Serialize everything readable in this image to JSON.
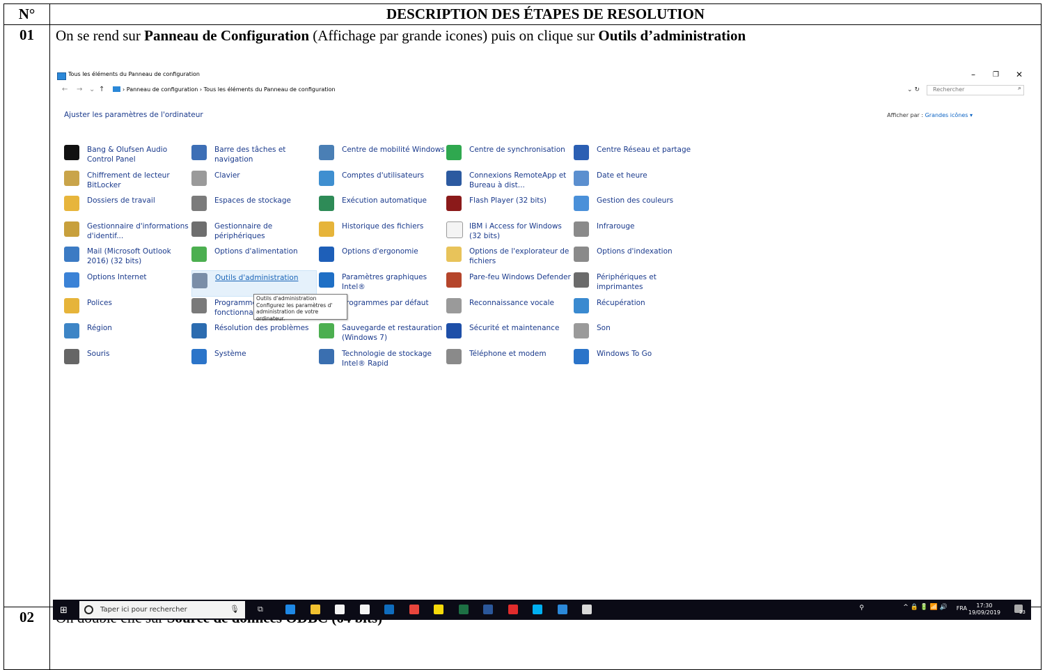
{
  "header": {
    "col_n": "N°",
    "col_desc": "DESCRIPTION DES ÉTAPES DE RESOLUTION"
  },
  "steps": [
    {
      "num": "01",
      "text_parts": [
        "On se rend sur ",
        "Panneau de Configuration",
        " (Affichage par grande icones) puis on clique sur ",
        "Outils d’administration"
      ]
    },
    {
      "num": "02",
      "text_parts": [
        "On double clic sur ",
        "Source de données ODBC (64 bits)"
      ]
    }
  ],
  "screenshot": {
    "window_title": "Tous les éléments du Panneau de configuration",
    "breadcrumb": "›  Panneau de configuration  ›  Tous les éléments du Panneau de configuration",
    "search_placeholder": "Rechercher",
    "adjust_link": "Ajuster les paramètres de l'ordinateur",
    "view_by_label": "Afficher par :",
    "view_by_value": "Grandes icônes ▾",
    "items": [
      {
        "label": "Bang & Olufsen Audio Control Panel",
        "icon": "bang-olufsen-icon",
        "color": "#111111"
      },
      {
        "label": "Barre des tâches et navigation",
        "icon": "taskbar-icon",
        "color": "#3d6fb6"
      },
      {
        "label": "Centre de mobilité Windows",
        "icon": "mobility-center-icon",
        "color": "#4a7fb5"
      },
      {
        "label": "Centre de synchronisation",
        "icon": "sync-center-icon",
        "color": "#2fa84f"
      },
      {
        "label": "Centre Réseau et partage",
        "icon": "network-icon",
        "color": "#2b5fb3"
      },
      {
        "label": "Chiffrement de lecteur BitLocker",
        "icon": "bitlocker-icon",
        "color": "#c9a44a"
      },
      {
        "label": "Clavier",
        "icon": "keyboard-icon",
        "color": "#9a9a9a"
      },
      {
        "label": "Comptes d'utilisateurs",
        "icon": "user-accounts-icon",
        "color": "#3f8fd0"
      },
      {
        "label": "Connexions RemoteApp et Bureau à dist...",
        "icon": "remoteapp-icon",
        "color": "#2c5aa0"
      },
      {
        "label": "Date et heure",
        "icon": "date-time-icon",
        "color": "#5b8fcf"
      },
      {
        "label": "Dossiers de travail",
        "icon": "work-folders-icon",
        "color": "#e7b53c"
      },
      {
        "label": "Espaces de stockage",
        "icon": "storage-spaces-icon",
        "color": "#7b7b7b"
      },
      {
        "label": "Exécution automatique",
        "icon": "autoplay-icon",
        "color": "#2e8b57"
      },
      {
        "label": "Flash Player (32 bits)",
        "icon": "flash-player-icon",
        "color": "#8b1a1a"
      },
      {
        "label": "Gestion des couleurs",
        "icon": "color-management-icon",
        "color": "#4a90d9"
      },
      {
        "label": "Gestionnaire d'informations d'identif...",
        "icon": "credential-manager-icon",
        "color": "#c8a03c"
      },
      {
        "label": "Gestionnaire de périphériques",
        "icon": "device-manager-icon",
        "color": "#6e6e6e"
      },
      {
        "label": "Historique des fichiers",
        "icon": "file-history-icon",
        "color": "#e6b43a"
      },
      {
        "label": "IBM i Access for Windows (32 bits)",
        "icon": "ibm-access-icon",
        "color": "#f4f4f4"
      },
      {
        "label": "Infrarouge",
        "icon": "infrared-icon",
        "color": "#8a8a8a"
      },
      {
        "label": "Mail (Microsoft Outlook 2016) (32 bits)",
        "icon": "mail-icon",
        "color": "#3c7bc4"
      },
      {
        "label": "Options d'alimentation",
        "icon": "power-options-icon",
        "color": "#4caf50"
      },
      {
        "label": "Options d'ergonomie",
        "icon": "ease-of-access-icon",
        "color": "#1e5fb8"
      },
      {
        "label": "Options de l'explorateur de fichiers",
        "icon": "explorer-options-icon",
        "color": "#e8c35a"
      },
      {
        "label": "Options d'indexation",
        "icon": "indexing-icon",
        "color": "#8a8a8a"
      },
      {
        "label": "Options Internet",
        "icon": "internet-options-icon",
        "color": "#3b82d6"
      },
      {
        "label": "Outils d'administration",
        "icon": "admin-tools-icon",
        "color": "#7a8ea8"
      },
      {
        "label": "Paramètres graphiques Intel®",
        "icon": "intel-graphics-icon",
        "color": "#1f6fc5"
      },
      {
        "label": "Pare-feu Windows Defender",
        "icon": "firewall-icon",
        "color": "#b5452b"
      },
      {
        "label": "Périphériques et imprimantes",
        "icon": "devices-printers-icon",
        "color": "#6b6b6b"
      },
      {
        "label": "Polices",
        "icon": "fonts-icon",
        "color": "#e6b43a"
      },
      {
        "label": "Programmes et fonctionnalités",
        "icon": "programs-icon",
        "color": "#7a7a7a"
      },
      {
        "label": "Programmes par défaut",
        "icon": "default-programs-icon",
        "color": "#3a7bd5"
      },
      {
        "label": "Reconnaissance vocale",
        "icon": "speech-icon",
        "color": "#9a9a9a"
      },
      {
        "label": "Récupération",
        "icon": "recovery-icon",
        "color": "#3a8ad0"
      },
      {
        "label": "Région",
        "icon": "region-icon",
        "color": "#3d85c6"
      },
      {
        "label": "Résolution des problèmes",
        "icon": "troubleshooting-icon",
        "color": "#2c6cb0"
      },
      {
        "label": "Sauvegarde et restauration (Windows 7)",
        "icon": "backup-icon",
        "color": "#4caf50"
      },
      {
        "label": "Sécurité et maintenance",
        "icon": "security-maintenance-icon",
        "color": "#1e4fa8"
      },
      {
        "label": "Son",
        "icon": "sound-icon",
        "color": "#9a9a9a"
      },
      {
        "label": "Souris",
        "icon": "mouse-icon",
        "color": "#666666"
      },
      {
        "label": "Système",
        "icon": "system-icon",
        "color": "#2b74c9"
      },
      {
        "label": "Technologie de stockage Intel® Rapid",
        "icon": "intel-rst-icon",
        "color": "#3a6fb0"
      },
      {
        "label": "Téléphone et modem",
        "icon": "phone-modem-icon",
        "color": "#8a8a8a"
      },
      {
        "label": "Windows To Go",
        "icon": "windows-to-go-icon",
        "color": "#2b74c9"
      }
    ],
    "tooltip": {
      "title": "Outils d'administration",
      "body": "Configurez les paramètres d' administration de votre ordinateur."
    },
    "taskbar": {
      "search_placeholder": "Taper ici pour rechercher",
      "apps": [
        {
          "icon": "edge-icon",
          "color": "#1e88e5"
        },
        {
          "icon": "file-explorer-icon",
          "color": "#f2c230"
        },
        {
          "icon": "store-icon",
          "color": "#f4f4f4"
        },
        {
          "icon": "mail-app-icon",
          "color": "#f4f4f4"
        },
        {
          "icon": "outlook-icon",
          "color": "#0f6cbd"
        },
        {
          "icon": "chrome-icon",
          "color": "#e8453c"
        },
        {
          "icon": "sticky-notes-icon",
          "color": "#f5d90a"
        },
        {
          "icon": "excel-icon",
          "color": "#1d7044"
        },
        {
          "icon": "word-icon",
          "color": "#2b579a"
        },
        {
          "icon": "acrobat-icon",
          "color": "#e12c2c"
        },
        {
          "icon": "skype-icon",
          "color": "#00aff0"
        },
        {
          "icon": "control-panel-icon",
          "color": "#2b88d8"
        },
        {
          "icon": "paint-icon",
          "color": "#d9d9d9"
        }
      ],
      "language": "FRA",
      "time": "17:30",
      "date": "19/09/2019",
      "notifications": "23"
    }
  }
}
